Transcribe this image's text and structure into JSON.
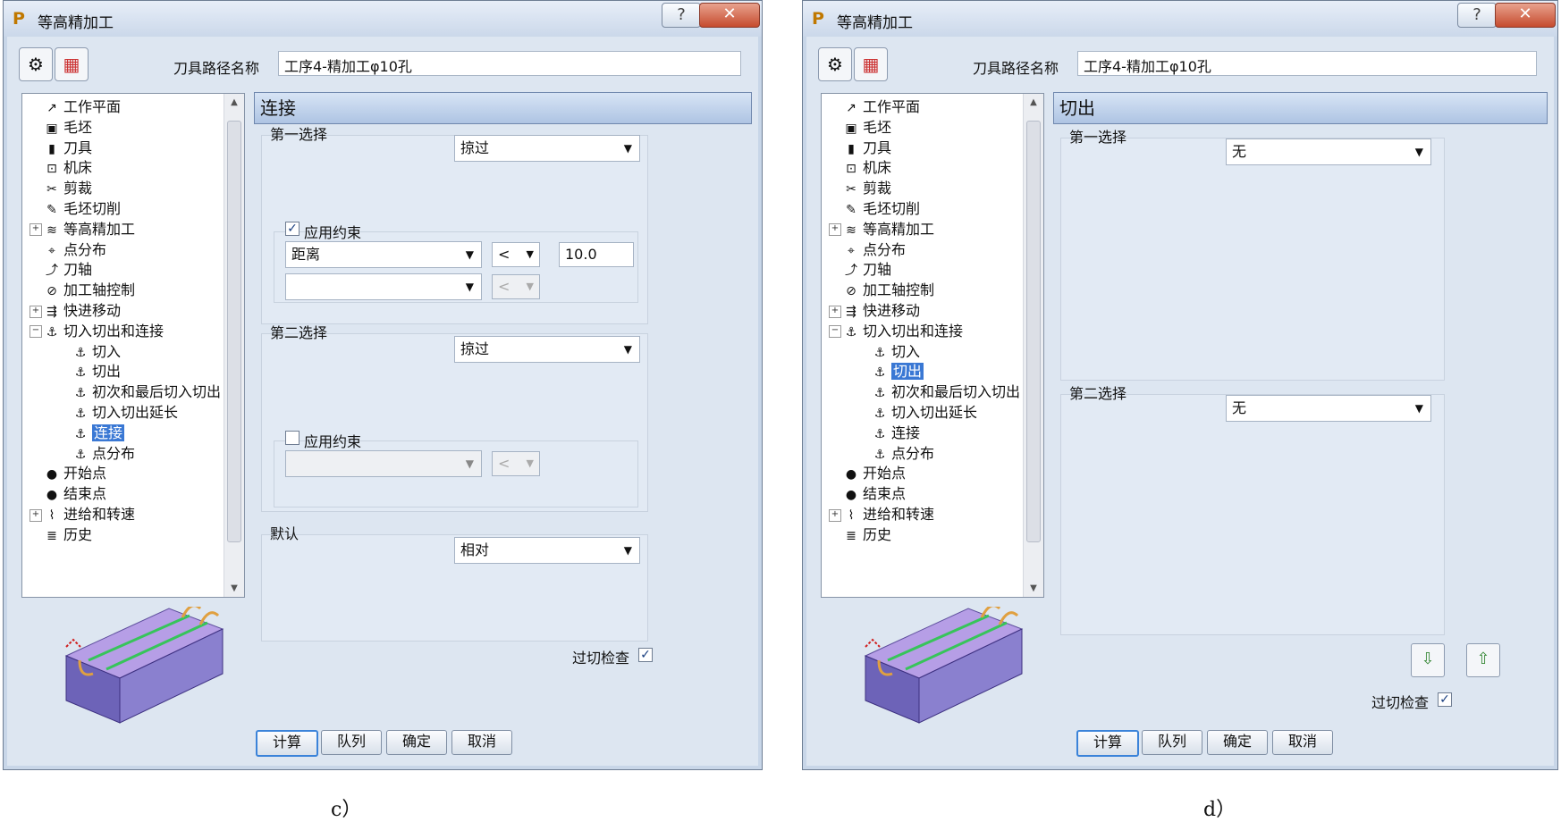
{
  "dialogs": {
    "c": {
      "title": "等高精加工",
      "toolpath_name_label": "刀具路径名称",
      "toolpath_name_value": "工序4-精加工φ10孔",
      "section_title": "连接",
      "first_choice": {
        "label": "第一选择",
        "value": "掠过"
      },
      "apply_constraint_1": {
        "label": "应用约束",
        "checked": true,
        "field": "距离",
        "operator": "<",
        "value": "10.0",
        "field2": ""
      },
      "second_choice": {
        "label": "第二选择",
        "value": "掠过"
      },
      "apply_constraint_2": {
        "label": "应用约束",
        "checked": false
      },
      "default": {
        "label": "默认",
        "value": "相对"
      },
      "gouge_check_label": "过切检查",
      "gouge_check": true,
      "selected_tree_item": "连接"
    },
    "d": {
      "title": "等高精加工",
      "toolpath_name_label": "刀具路径名称",
      "toolpath_name_value": "工序4-精加工φ10孔",
      "section_title": "切出",
      "first_choice": {
        "label": "第一选择",
        "value": "无"
      },
      "second_choice": {
        "label": "第二选择",
        "value": "无"
      },
      "gouge_check_label": "过切检查",
      "gouge_check": true,
      "selected_tree_item": "切出"
    }
  },
  "tree_items": [
    "工作平面",
    "毛坯",
    "刀具",
    "机床",
    "剪裁",
    "毛坯切削",
    "等高精加工",
    "点分布",
    "刀轴",
    "加工轴控制",
    "快进移动",
    "切入切出和连接",
    "切入",
    "切出",
    "初次和最后切入切出",
    "切入切出延长",
    "连接",
    "点分布",
    "开始点",
    "结束点",
    "进给和转速",
    "历史"
  ],
  "buttons": {
    "calculate": "计算",
    "queue": "队列",
    "ok": "确定",
    "cancel": "取消"
  },
  "captions": {
    "c": "c）",
    "d": "d）"
  },
  "colors": {
    "selection": "#3a78d4",
    "header": "#aec4e3",
    "dialog_bg": "#dde6f1"
  }
}
